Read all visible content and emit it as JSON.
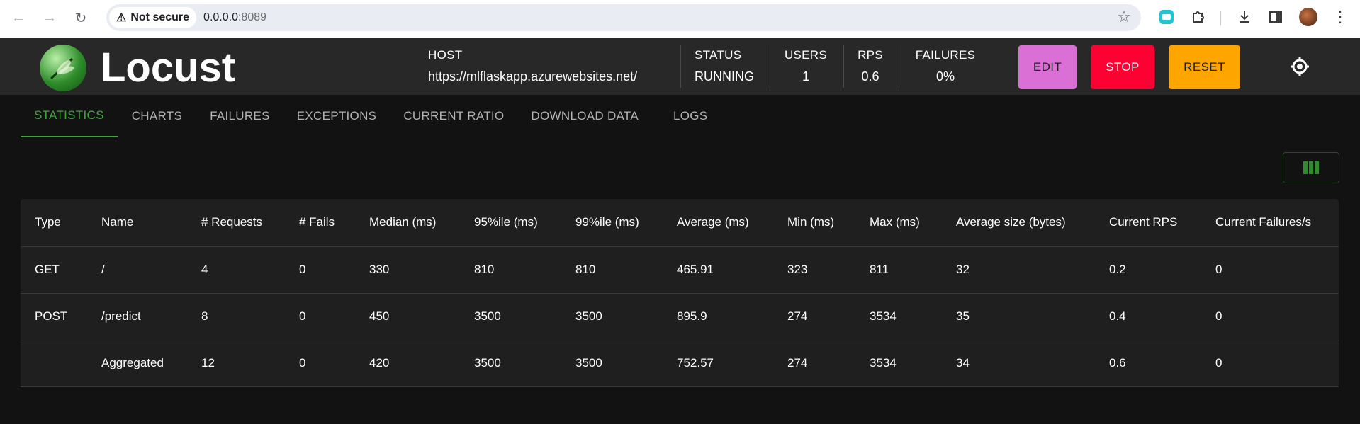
{
  "browser": {
    "security_label": "Not secure",
    "url_host": "0.0.0.0",
    "url_port": ":8089"
  },
  "app": {
    "name": "Locust",
    "host_label": "HOST",
    "host_value": "https://mlflaskapp.azurewebsites.net/",
    "status_label": "STATUS",
    "status_value": "RUNNING",
    "users_label": "USERS",
    "users_value": "1",
    "rps_label": "RPS",
    "rps_value": "0.6",
    "failures_label": "FAILURES",
    "failures_value": "0%",
    "edit_label": "EDIT",
    "stop_label": "STOP",
    "reset_label": "RESET",
    "colors": {
      "edit": "#da70d6",
      "stop": "#ff0033",
      "reset": "#ffa500",
      "accent": "#3ca53c"
    }
  },
  "tabs": [
    {
      "label": "STATISTICS"
    },
    {
      "label": "CHARTS"
    },
    {
      "label": "FAILURES"
    },
    {
      "label": "EXCEPTIONS"
    },
    {
      "label": "CURRENT RATIO"
    },
    {
      "label": "DOWNLOAD DATA"
    },
    {
      "label": "LOGS"
    }
  ],
  "table": {
    "headers": [
      "Type",
      "Name",
      "# Requests",
      "# Fails",
      "Median (ms)",
      "95%ile (ms)",
      "99%ile (ms)",
      "Average (ms)",
      "Min (ms)",
      "Max (ms)",
      "Average size (bytes)",
      "Current RPS",
      "Current Failures/s"
    ],
    "rows": [
      [
        "GET",
        "/",
        "4",
        "0",
        "330",
        "810",
        "810",
        "465.91",
        "323",
        "811",
        "32",
        "0.2",
        "0"
      ],
      [
        "POST",
        "/predict",
        "8",
        "0",
        "450",
        "3500",
        "3500",
        "895.9",
        "274",
        "3534",
        "35",
        "0.4",
        "0"
      ],
      [
        "",
        "Aggregated",
        "12",
        "0",
        "420",
        "3500",
        "3500",
        "752.57",
        "274",
        "3534",
        "34",
        "0.6",
        "0"
      ]
    ]
  }
}
